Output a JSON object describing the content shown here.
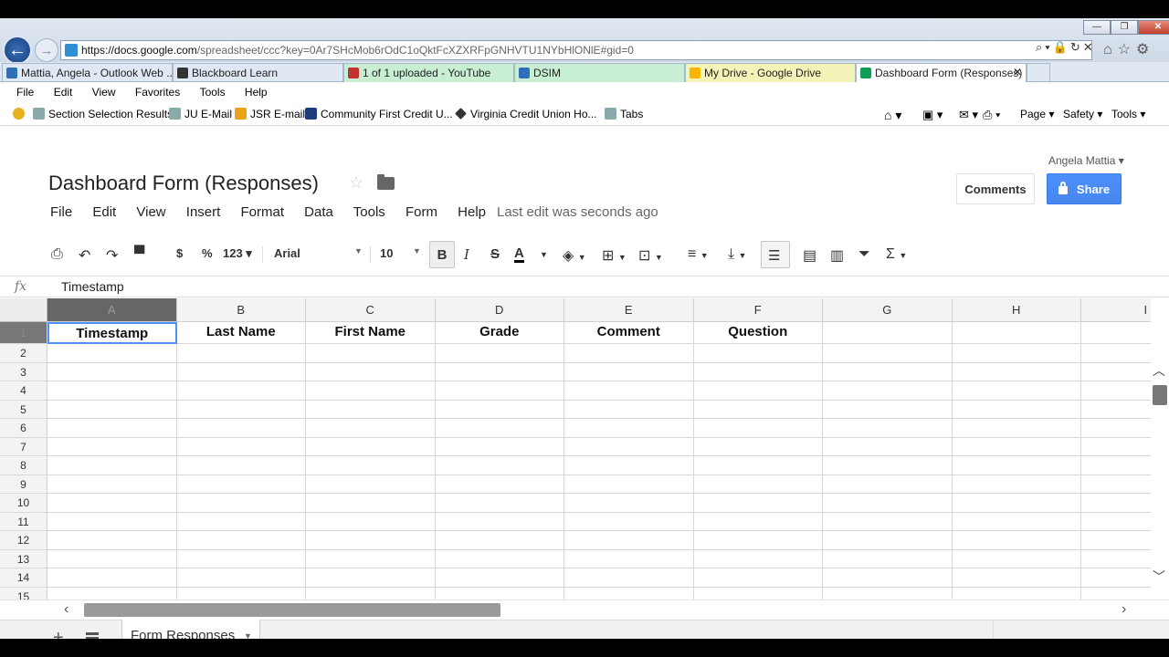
{
  "browser": {
    "url_host": "https://docs.google.com",
    "url_rest": "/spreadsheet/ccc?key=0Ar7SHcMob6rOdC1oQktFcXZXRFpGNHVTU1NYbHlONlE#gid=0",
    "addr_tools": "⌕▾🔒↻✕",
    "right_icons": "⌂☆⚙",
    "window_controls": {
      "minimize": "—",
      "maximize": "❐",
      "close": "✕"
    },
    "tabs": [
      {
        "label": "Mattia, Angela - Outlook Web ...",
        "icon_color": "#2f6fb8"
      },
      {
        "label": "Blackboard Learn",
        "icon_color": "#333333"
      },
      {
        "label": "1 of 1 uploaded - YouTube",
        "icon_color": "#c4302b"
      },
      {
        "label": "DSIM",
        "icon_color": "#2f6fb8"
      },
      {
        "label": "My Drive - Google Drive",
        "icon_color": "#f4b400"
      },
      {
        "label": "Dashboard Form (Responses)",
        "icon_color": "#0f9d58"
      }
    ],
    "tab_colors": {
      "youtube": "#c8eed4",
      "dsim": "#c8eed4",
      "drive": "#f4f4b8"
    },
    "menu": [
      "File",
      "Edit",
      "View",
      "Favorites",
      "Tools",
      "Help"
    ],
    "favorites": [
      "Section Selection Results",
      "JU E-Mail",
      "JSR E-mail",
      "Community First Credit U...",
      "Virginia Credit Union  Ho...",
      "Tabs"
    ],
    "commands": {
      "page": "Page ▾",
      "safety": "Safety ▾",
      "tools": "Tools ▾"
    }
  },
  "doc": {
    "title": "Dashboard Form (Responses)",
    "user": "Angela Mattia",
    "comments_label": "Comments",
    "share_label": "Share",
    "menu": [
      "File",
      "Edit",
      "View",
      "Insert",
      "Format",
      "Data",
      "Tools",
      "Form",
      "Help"
    ],
    "last_edit": "Last edit was seconds ago",
    "toolbar": {
      "currency": "$",
      "percent": "%",
      "number_format": "123 ▾",
      "font": "Arial",
      "font_size": "10",
      "bold": "B",
      "italic": "I",
      "strike": "S",
      "text_color": "A"
    },
    "formula": {
      "fx": "fx",
      "value": "Timestamp"
    }
  },
  "grid": {
    "columns": [
      "A",
      "B",
      "C",
      "D",
      "E",
      "F",
      "G",
      "H",
      "I"
    ],
    "header_row": [
      "Timestamp",
      "Last Name",
      "First Name",
      "Grade",
      "Comment",
      "Question",
      "",
      "",
      ""
    ],
    "row_numbers": [
      "1",
      "2",
      "3",
      "4",
      "5",
      "6",
      "7",
      "8",
      "9",
      "10",
      "11",
      "12",
      "13",
      "14",
      "15"
    ]
  },
  "sheets": {
    "tabs": [
      {
        "label": "Form Responses"
      }
    ]
  }
}
